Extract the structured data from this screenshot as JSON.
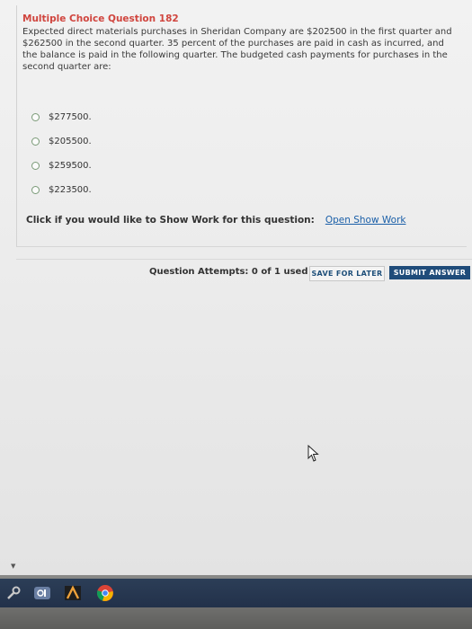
{
  "question": {
    "title": "Multiple Choice Question 182",
    "body": "Expected direct materials purchases in Sheridan Company are $202500 in the first quarter and $262500 in the second quarter. 35 percent of the purchases are paid in cash as incurred, and the balance is paid in the following quarter. The budgeted cash payments for purchases in the second quarter are:"
  },
  "options": [
    {
      "label": "$277500."
    },
    {
      "label": "$205500."
    },
    {
      "label": "$259500."
    },
    {
      "label": "$223500."
    }
  ],
  "show_work": {
    "label": "Click if you would like to Show Work for this question:",
    "link": "Open Show Work"
  },
  "footer": {
    "attempts": "Question Attempts: 0 of 1 used",
    "save_label": "SAVE FOR LATER",
    "submit_label": "SUBMIT ANSWER"
  },
  "taskbar": {
    "icons": [
      "tools-icon",
      "onenote-icon",
      "mail-icon",
      "chrome-icon"
    ]
  },
  "colors": {
    "title": "#d0453e",
    "link": "#1a5fa8",
    "submit_bg": "#1f4c7a",
    "taskbar": "#2c3e57"
  }
}
